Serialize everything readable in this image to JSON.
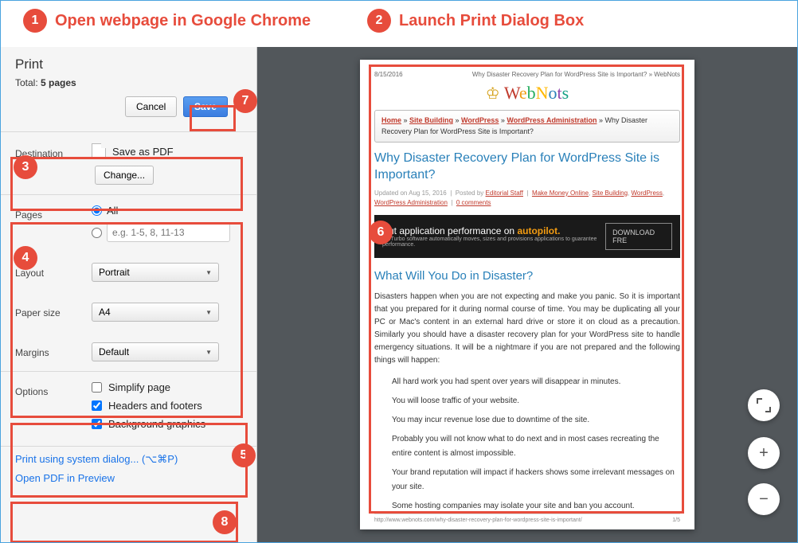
{
  "annotations": {
    "a1": "1",
    "a1_text": "Open webpage in Google Chrome",
    "a2": "2",
    "a2_text": "Launch Print Dialog Box",
    "a3": "3",
    "a4": "4",
    "a5": "5",
    "a6": "6",
    "a7": "7",
    "a8": "8"
  },
  "sidebar": {
    "title": "Print",
    "total_prefix": "Total: ",
    "total_value": "5 pages",
    "cancel": "Cancel",
    "save": "Save",
    "dest_label": "Destination",
    "dest_value": "Save as PDF",
    "change": "Change...",
    "pages_label": "Pages",
    "pages_all": "All",
    "pages_placeholder": "e.g. 1-5, 8, 11-13",
    "layout_label": "Layout",
    "layout_value": "Portrait",
    "paper_label": "Paper size",
    "paper_value": "A4",
    "margins_label": "Margins",
    "margins_value": "Default",
    "options_label": "Options",
    "opt_simplify": "Simplify page",
    "opt_headers": "Headers and footers",
    "opt_bg": "Background graphics",
    "sys_dialog": "Print using system dialog... (⌥⌘P)",
    "open_preview": "Open PDF in Preview"
  },
  "preview": {
    "header_date": "8/15/2016",
    "header_title": "Why Disaster Recovery Plan for WordPress Site is Important? » WebNots",
    "logo": "WebNots",
    "bc_home": "Home",
    "bc_sb": "Site Building",
    "bc_wp": "WordPress",
    "bc_wpa": "WordPress Administration",
    "bc_sep": " » ",
    "bc_tail": "Why Disaster Recovery Plan for WordPress Site is Important?",
    "article_title": "Why Disaster Recovery Plan for WordPress Site is Important?",
    "meta_updated": "Updated on Aug 15, 2016",
    "meta_posted": "Posted by",
    "meta_author": "Editorial Staff",
    "meta_mmo": "Make Money Online",
    "meta_sb": "Site Building",
    "meta_wp": "WordPress",
    "meta_wpa": "WordPress Administration",
    "meta_comments": "0 comments",
    "banner_line1": "Put application performance on ",
    "banner_auto": "autopilot.",
    "banner_sub": "VMTurbo software automatically moves, sizes and provisions applications to guarantee performance.",
    "banner_dl": "DOWNLOAD FRE",
    "h2": "What Will You Do in Disaster?",
    "p1": "Disasters happen when you are not expecting and make you panic. So it is important that you prepared for it during normal course of time. You may be duplicating all your PC or Mac's content in an external hard drive or store it on cloud as a precaution. Similarly you should have a disaster recovery plan for your WordPress site to handle emergency situations. It will be a nightmare if you are not prepared and the following things will happen:",
    "b1": "All hard work you had spent over years will disappear in minutes.",
    "b2": "You will loose traffic of your website.",
    "b3": "You may incur revenue lose due to downtime of the site.",
    "b4": "Probably you will not know what to do next and in most cases recreating the entire content is almost impossible.",
    "b5": "Your brand reputation will impact if hackers shows some irrelevant messages on your site.",
    "b6": "Some hosting companies may isolate your site and ban you account.",
    "footer_url": "http://www.webnots.com/why-disaster-recovery-plan-for-wordpress-site-is-important/",
    "footer_page": "1/5"
  }
}
